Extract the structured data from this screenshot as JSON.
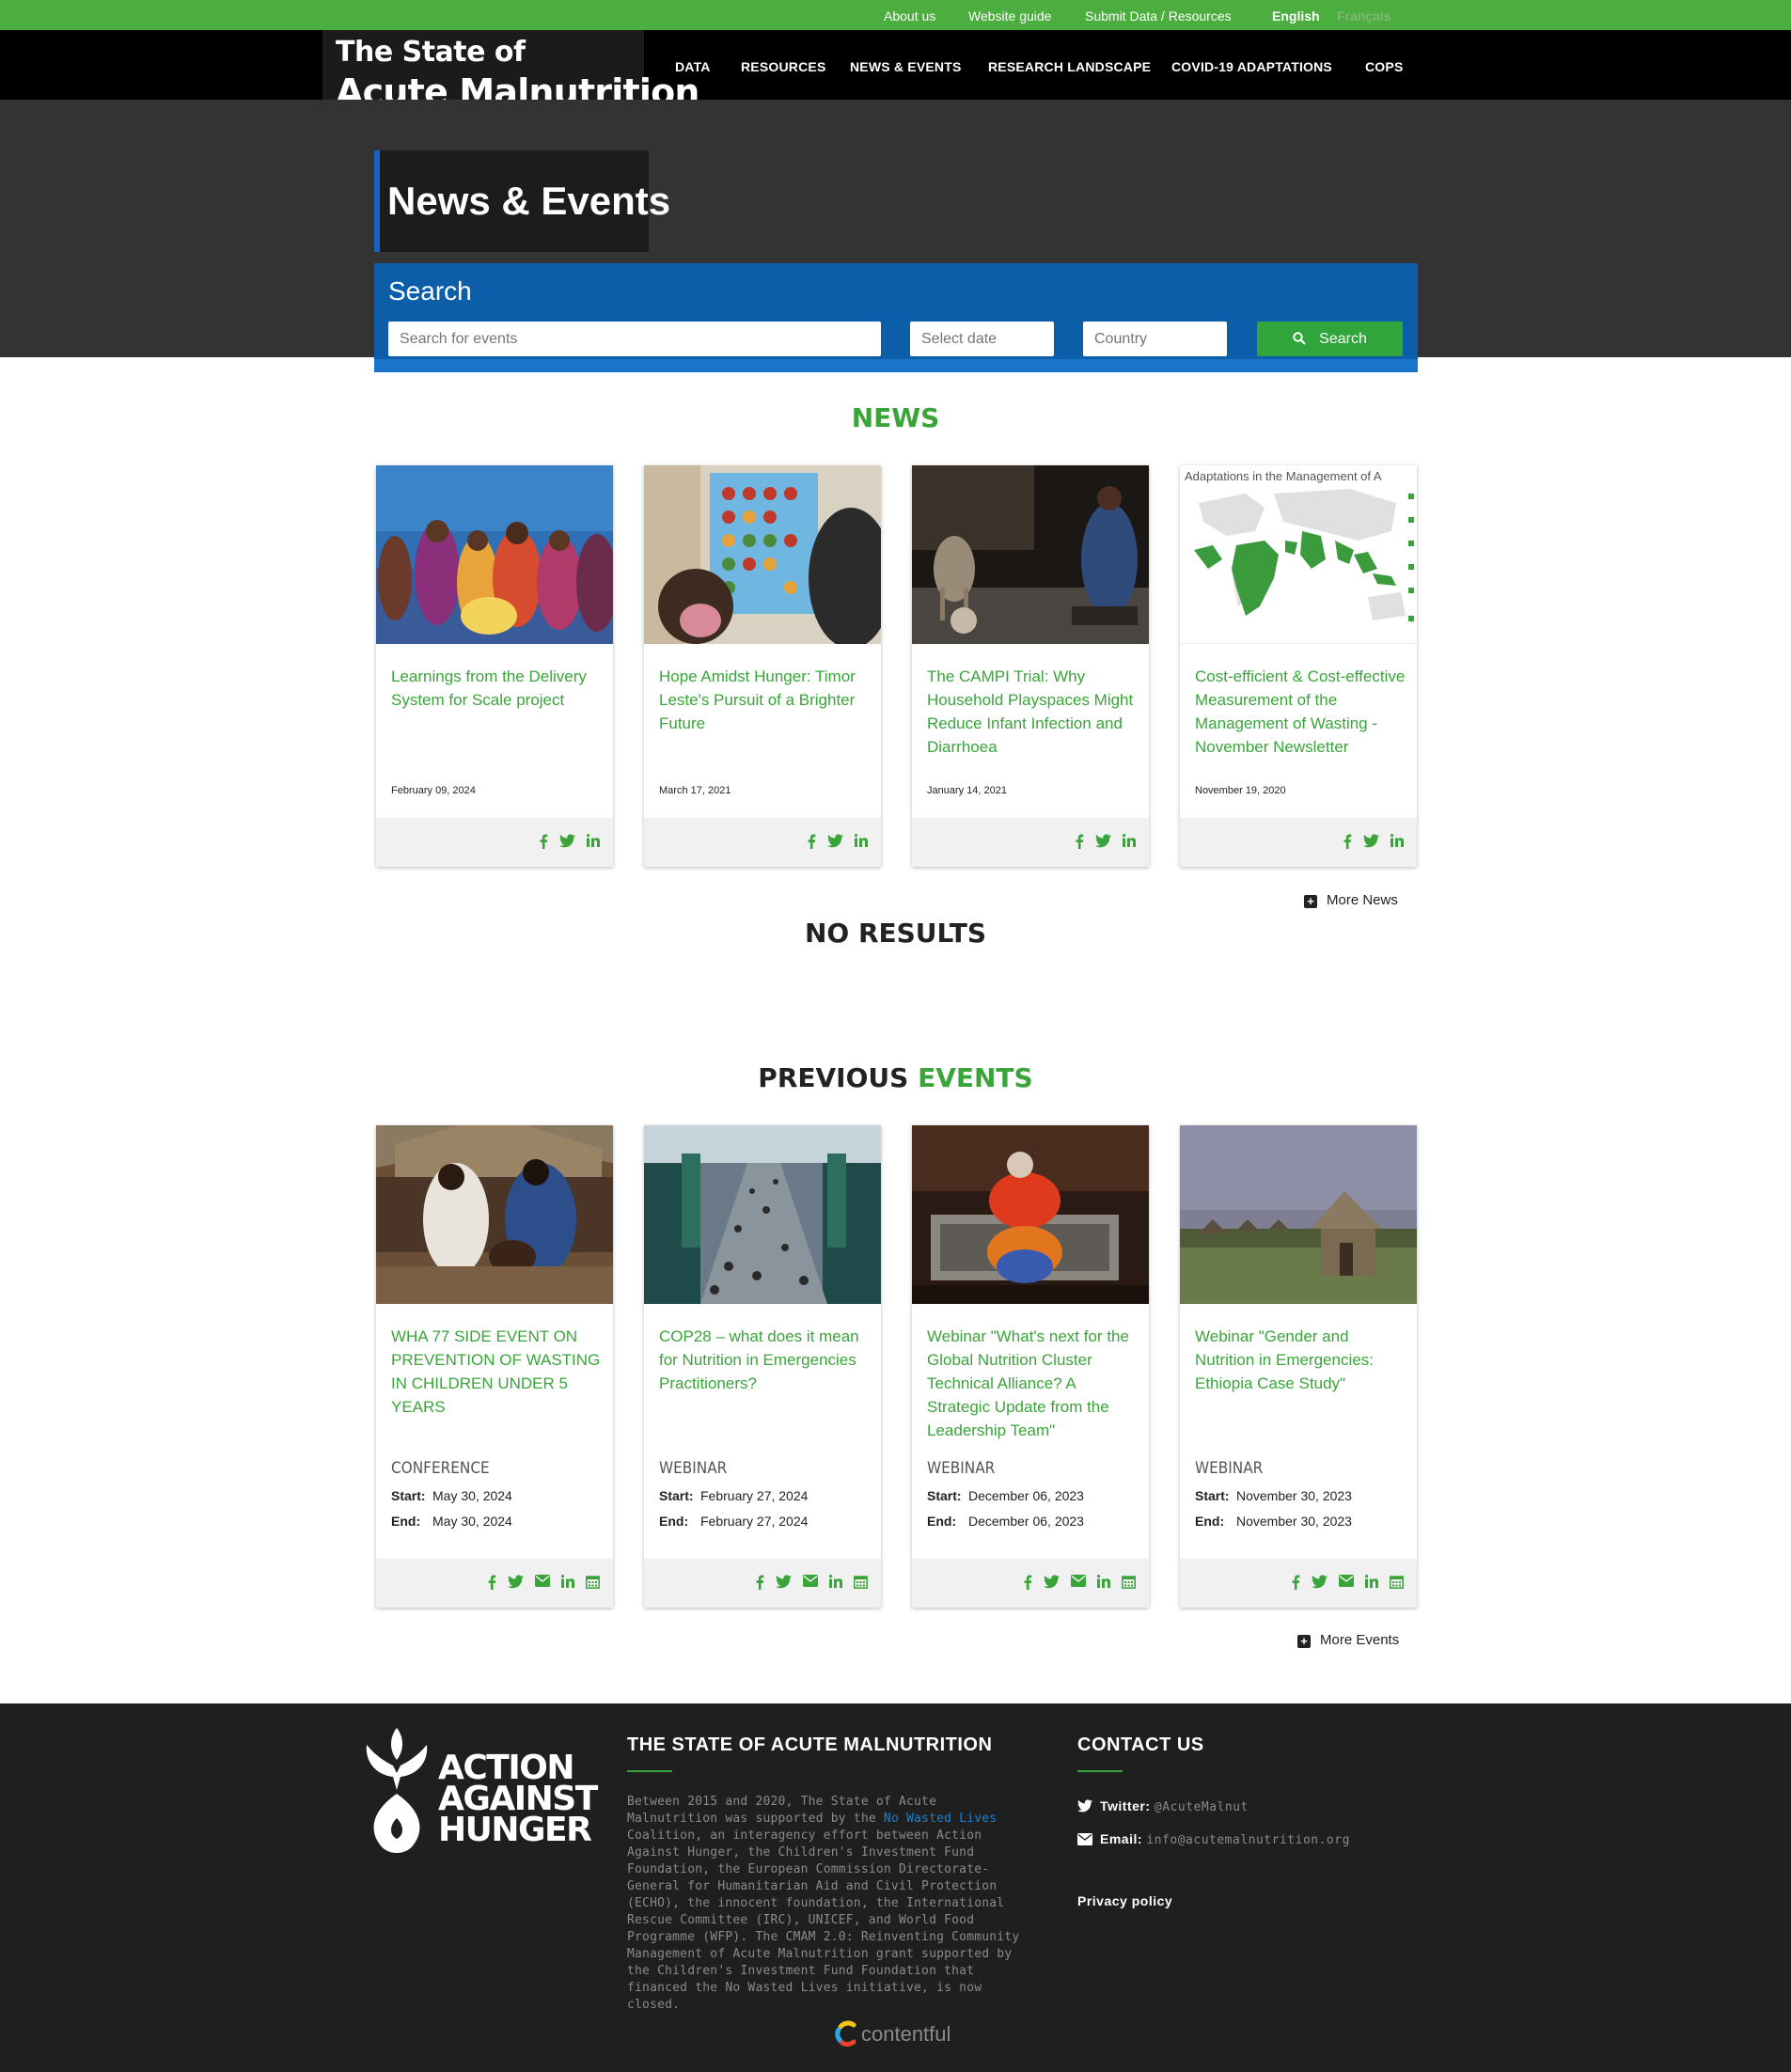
{
  "topbar": {
    "about": "About us",
    "guide": "Website guide",
    "submit": "Submit Data / Resources",
    "lang_en": "English",
    "lang_fr": "Français"
  },
  "brand": {
    "line1": "The State of",
    "line2": "Acute Malnutrition"
  },
  "nav": [
    "DATA",
    "RESOURCES",
    "NEWS & EVENTS",
    "RESEARCH LANDSCAPE",
    "COVID-19 ADAPTATIONS",
    "COPS"
  ],
  "page_title": "News & Events",
  "search": {
    "heading": "Search",
    "events_placeholder": "Search for events",
    "date_placeholder": "Select date",
    "country_placeholder": "Country",
    "button": "Search"
  },
  "news": {
    "heading": "NEWS",
    "items": [
      {
        "title": "Learnings from the Delivery System for Scale project",
        "date": "February 09, 2024"
      },
      {
        "title": "Hope Amidst Hunger: Timor Leste's Pursuit of a Brighter Future",
        "date": "March 17, 2021"
      },
      {
        "title": "The CAMPI Trial: Why Household Playspaces Might Reduce Infant Infection and Diarrhoea",
        "date": "January 14, 2021"
      },
      {
        "title": "Cost-efficient & Cost-effective Measurement of the Management of Wasting - November Newsletter",
        "date": "November 19, 2020",
        "image_caption": "Adaptations in the Management of A"
      }
    ],
    "more": "More News"
  },
  "no_results": "NO RESULTS",
  "events": {
    "heading_part1": "PREVIOUS",
    "heading_part2": "EVENTS",
    "start_label": "Start:",
    "end_label": "End:",
    "items": [
      {
        "title": "WHA 77 SIDE EVENT ON PREVENTION OF WASTING IN CHILDREN UNDER 5 YEARS",
        "type": "CONFERENCE",
        "start": "May 30, 2024",
        "end": "May 30, 2024"
      },
      {
        "title": "COP28 – what does it mean for Nutrition in Emergencies Practitioners?",
        "type": "WEBINAR",
        "start": "February 27, 2024",
        "end": "February 27, 2024"
      },
      {
        "title": "Webinar \"What's next for the Global Nutrition Cluster Technical Alliance? A Strategic Update from the Leadership Team\"",
        "type": "WEBINAR",
        "start": "December 06, 2023",
        "end": "December 06, 2023"
      },
      {
        "title": "Webinar \"Gender and Nutrition in Emergencies: Ethiopia Case Study\"",
        "type": "WEBINAR",
        "start": "November 30, 2023",
        "end": "November 30, 2023"
      }
    ],
    "more": "More Events"
  },
  "footer": {
    "logo_lines": [
      "ACTION",
      "AGAINST",
      "HUNGER"
    ],
    "about_heading": "THE STATE OF ACUTE MALNUTRITION",
    "about_pre": "Between 2015 and 2020, The State of Acute Malnutrition was supported by the ",
    "about_link": "No Wasted Lives",
    "about_post": " Coalition, an interagency effort between Action Against Hunger, the Children's Investment Fund Foundation, the European Commission Directorate-General for Humanitarian Aid and Civil Protection (ECHO), the innocent foundation, the International Rescue Committee (IRC), UNICEF, and World Food Programme (WFP). The CMAM 2.0: Reinventing Community Management of Acute Malnutrition grant supported by the Children's Investment Fund Foundation that financed the No Wasted Lives initiative, is now closed.",
    "contact_heading": "CONTACT US",
    "twitter_label": "Twitter:",
    "twitter_value": "@AcuteMalnut",
    "email_label": "Email:",
    "email_value": "info@acutemalnutrition.org",
    "privacy": "Privacy policy",
    "powered": "contentful"
  },
  "colors": {
    "green": "#3aa43a",
    "topbar": "#4cae3f",
    "search_blue": "#0d5ea8",
    "hero": "#333333",
    "footer": "#1f1f1f"
  }
}
